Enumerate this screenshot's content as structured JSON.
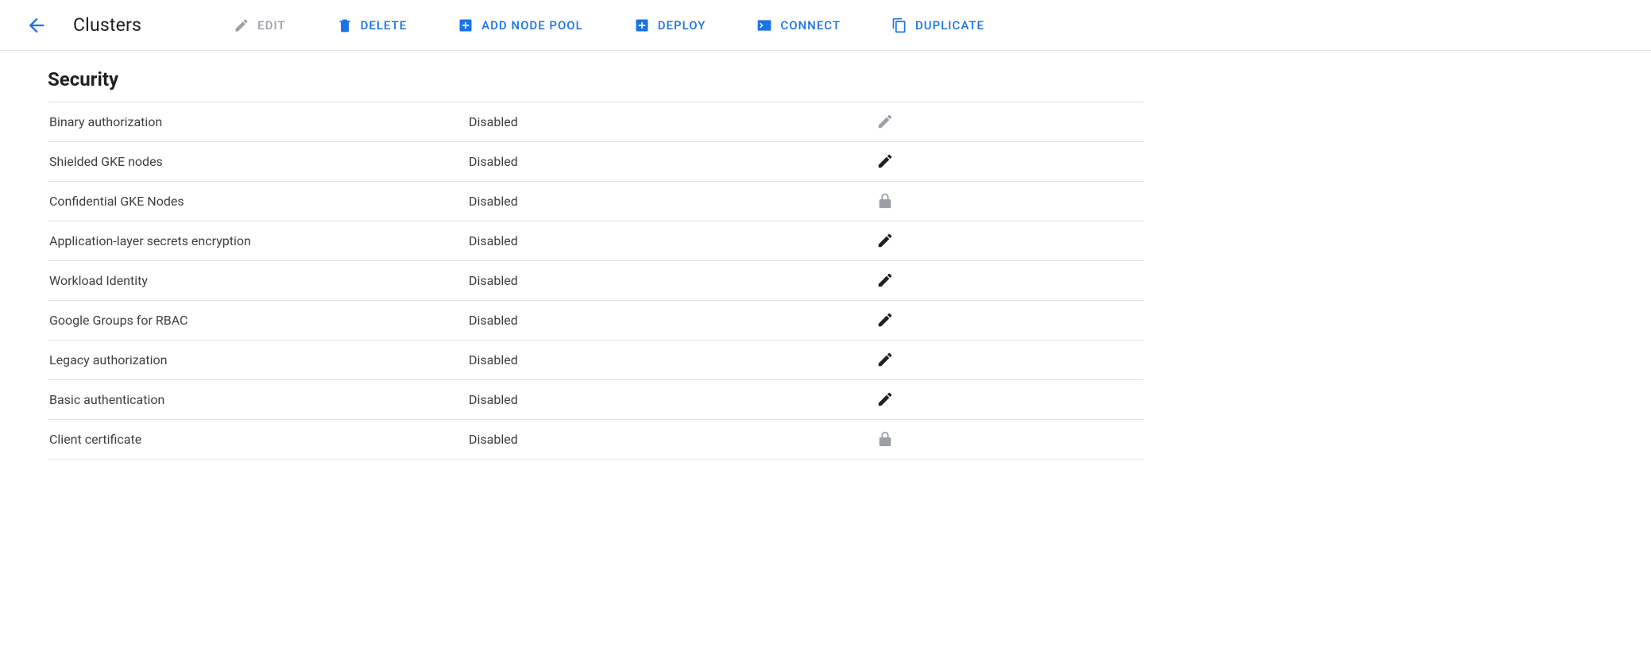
{
  "colors": {
    "primary": "#1a73e8",
    "muted": "#9aa0a6",
    "icon_dark": "#202124"
  },
  "header": {
    "title": "Clusters",
    "actions": [
      {
        "id": "edit",
        "label": "EDIT",
        "icon": "pencil",
        "enabled": false
      },
      {
        "id": "delete",
        "label": "DELETE",
        "icon": "trash",
        "enabled": true
      },
      {
        "id": "add-node-pool",
        "label": "ADD NODE POOL",
        "icon": "plus-box",
        "enabled": true
      },
      {
        "id": "deploy",
        "label": "DEPLOY",
        "icon": "plus-box",
        "enabled": true
      },
      {
        "id": "connect",
        "label": "CONNECT",
        "icon": "terminal",
        "enabled": true
      },
      {
        "id": "duplicate",
        "label": "DUPLICATE",
        "icon": "copy",
        "enabled": true
      }
    ]
  },
  "section": {
    "title": "Security",
    "rows": [
      {
        "label": "Binary authorization",
        "value": "Disabled",
        "action": "edit-muted"
      },
      {
        "label": "Shielded GKE nodes",
        "value": "Disabled",
        "action": "edit"
      },
      {
        "label": "Confidential GKE Nodes",
        "value": "Disabled",
        "action": "locked"
      },
      {
        "label": "Application-layer secrets encryption",
        "value": "Disabled",
        "action": "edit"
      },
      {
        "label": "Workload Identity",
        "value": "Disabled",
        "action": "edit"
      },
      {
        "label": "Google Groups for RBAC",
        "value": "Disabled",
        "action": "edit"
      },
      {
        "label": "Legacy authorization",
        "value": "Disabled",
        "action": "edit"
      },
      {
        "label": "Basic authentication",
        "value": "Disabled",
        "action": "edit"
      },
      {
        "label": "Client certificate",
        "value": "Disabled",
        "action": "locked"
      }
    ]
  }
}
